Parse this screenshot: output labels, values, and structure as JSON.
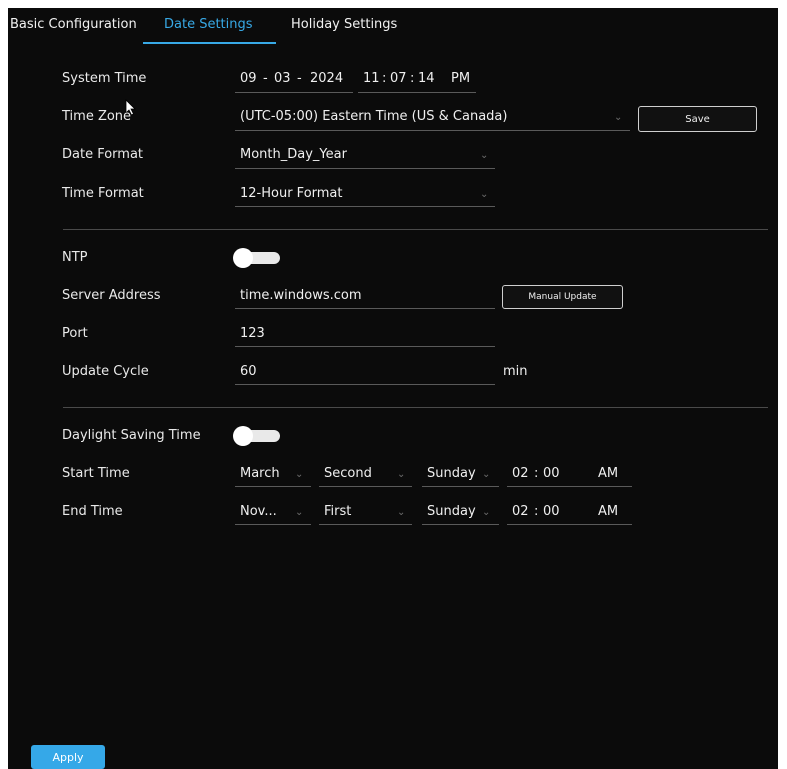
{
  "tabs": [
    {
      "label": "Basic Configuration"
    },
    {
      "label": "Date Settings"
    },
    {
      "label": "Holiday Settings"
    }
  ],
  "active_tab": "Date Settings",
  "system_time": {
    "label": "System Time",
    "month": "09",
    "day": "03",
    "year": "2024",
    "hour": "11",
    "minute": "07",
    "second": "14",
    "ampm": "PM"
  },
  "time_zone": {
    "label": "Time Zone",
    "value": "(UTC-05:00) Eastern Time (US & Canada)"
  },
  "save_label": "Save",
  "date_format": {
    "label": "Date Format",
    "value": "Month_Day_Year"
  },
  "time_format": {
    "label": "Time Format",
    "value": "12-Hour Format"
  },
  "ntp": {
    "label": "NTP",
    "enabled": false
  },
  "server_address": {
    "label": "Server Address",
    "value": "time.windows.com"
  },
  "manual_update_label": "Manual Update",
  "port": {
    "label": "Port",
    "value": "123"
  },
  "update_cycle": {
    "label": "Update Cycle",
    "value": "60",
    "unit": "min"
  },
  "dst": {
    "label": "Daylight Saving Time",
    "enabled": false
  },
  "start_time": {
    "label": "Start Time",
    "month": "March",
    "week": "Second",
    "day": "Sunday",
    "hour": "02",
    "minute": "00",
    "ampm": "AM"
  },
  "end_time": {
    "label": "End Time",
    "month": "Nov...",
    "week": "First",
    "day": "Sunday",
    "hour": "02",
    "minute": "00",
    "ampm": "AM"
  },
  "apply_label": "Apply",
  "colors": {
    "accent": "#38a9e6",
    "background": "#0b0b0b"
  },
  "separators": {
    "date": "-",
    "time": ":"
  },
  "icons": {
    "dropdown": "chevron-down-icon",
    "cursor": "mouse-pointer-icon"
  }
}
